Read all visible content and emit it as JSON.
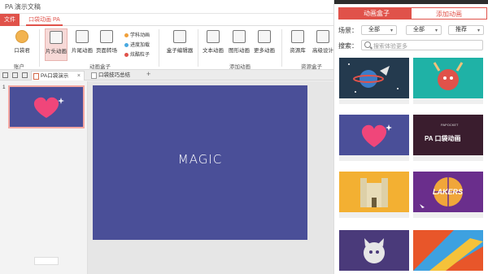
{
  "app": {
    "title": "PA 演示文稿"
  },
  "tabs": {
    "file": "文件",
    "ribbon_tab": "口袋动画 PA"
  },
  "ribbon": {
    "account_button": "口袋君",
    "buttons": [
      "片头动画",
      "片尾动画",
      "页面转场"
    ],
    "small_items": [
      "学科动画",
      "进度加载",
      "炫酷粒子"
    ],
    "box_editor": "盒子编辑器",
    "more_buttons": [
      "文本动画",
      "图形动画",
      "更多动画"
    ],
    "resource": [
      "资源库",
      "高级设计"
    ],
    "groups": {
      "account": "账户",
      "box": "动画盒子",
      "add": "添加动画",
      "resource": "资源盒子"
    }
  },
  "doctabs": {
    "tab1": "PA口袋演示",
    "tab2": "口袋技巧总结",
    "plus": "+"
  },
  "thumbnail": {
    "number": "1"
  },
  "slide": {
    "text": "MAGIC"
  },
  "panel": {
    "tab_active": "动画盒子",
    "tab_inactive": "添加动画",
    "scene_label": "场景：",
    "scene_value": "全部",
    "category_value": "全部",
    "sort_value": "推荐",
    "search_label": "搜索：",
    "search_placeholder": "搜索体验更多",
    "card_texts": {
      "pa": "PA 口袋动画",
      "pa_small": "PAPOCKET",
      "lakers": "LAKERS"
    }
  },
  "colors": {
    "accent": "#e0524a",
    "slide_bg": "#4a4f98",
    "heart": "#f0467a"
  }
}
